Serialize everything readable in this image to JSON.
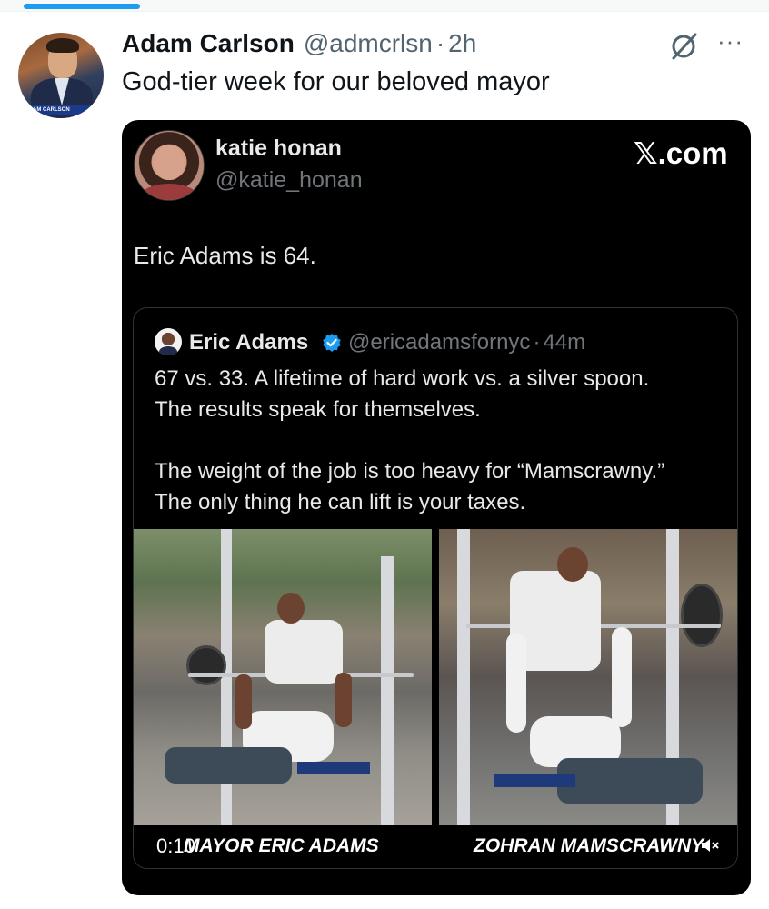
{
  "tweet": {
    "author_name": "Adam Carlson",
    "author_handle": "@admcrlsn",
    "separator": "·",
    "time": "2h",
    "text": "God-tier week for our beloved mayor",
    "avatar_banner": "AM CARLSON"
  },
  "embedded": {
    "author_name": "katie honan",
    "author_handle": "@katie_honan",
    "brand": "𝕏.com",
    "text": "Eric Adams is 64.",
    "quote": {
      "author_name": "Eric Adams",
      "author_handle": "@ericadamsfornyc",
      "separator": "·",
      "time": "44m",
      "lines": [
        "67 vs. 33. A lifetime of hard work vs. a silver spoon.",
        "The results speak for themselves.",
        "",
        "The weight of the job is too heavy for “Mamscrawny.”",
        "The only thing he can lift is your taxes."
      ],
      "video": {
        "timestamp": "0:10",
        "caption_left": "MAYOR ERIC ADAMS",
        "caption_right": "ZOHRAN MAMSCRAWNY"
      }
    }
  },
  "colors": {
    "accent": "#1d9bf0",
    "text_primary": "#0f1419",
    "text_secondary": "#536471",
    "card_bg": "#000000"
  },
  "icons": [
    "grok-icon",
    "more-icon",
    "verified-badge-icon",
    "mute-icon"
  ]
}
